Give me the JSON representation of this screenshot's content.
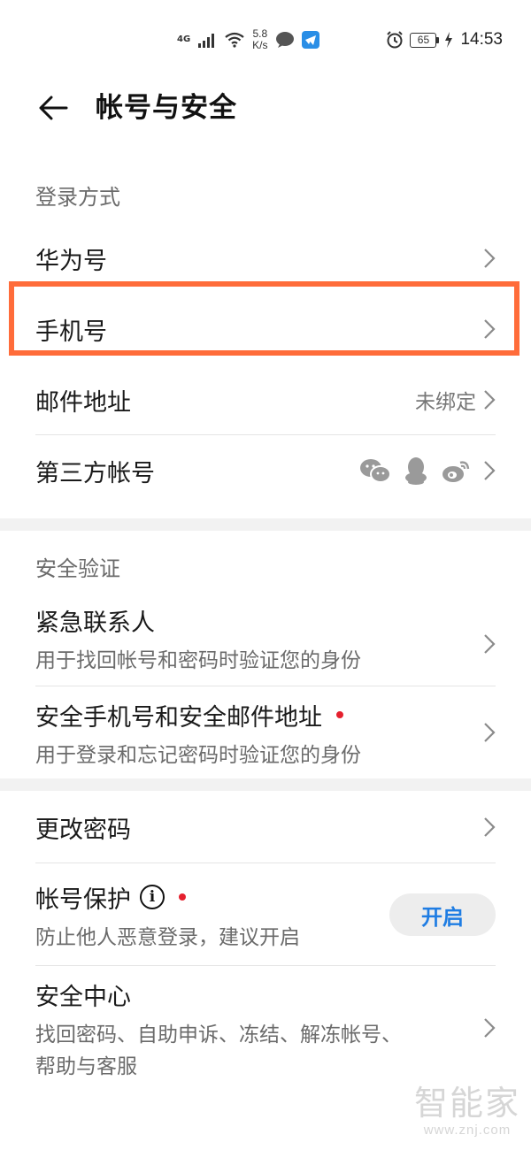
{
  "status_bar": {
    "network": "4G",
    "speed_value": "5.8",
    "speed_unit": "K/s",
    "battery": "65",
    "time": "14:53"
  },
  "header": {
    "title": "帐号与安全"
  },
  "login_section": {
    "header": "登录方式",
    "items": [
      {
        "title": "华为号"
      },
      {
        "title": "手机号"
      },
      {
        "title": "邮件地址",
        "value": "未绑定"
      },
      {
        "title": "第三方帐号"
      }
    ]
  },
  "security_section": {
    "header": "安全验证",
    "items": [
      {
        "title": "紧急联系人",
        "subtitle": "用于找回帐号和密码时验证您的身份"
      },
      {
        "title": "安全手机号和安全邮件地址",
        "subtitle": "用于登录和忘记密码时验证您的身份"
      }
    ]
  },
  "other_section": {
    "items": [
      {
        "title": "更改密码"
      },
      {
        "title": "帐号保护",
        "subtitle": "防止他人恶意登录，建议开启",
        "button": "开启"
      },
      {
        "title": "安全中心",
        "subtitle_line1": "找回密码、自助申诉、冻结、解冻帐号、",
        "subtitle_line2": "帮助与客服"
      }
    ]
  },
  "watermark": {
    "logo": "智能家",
    "url": "www.znj.com"
  },
  "colors": {
    "highlight": "#ff6c3a",
    "accent": "#1f7de3",
    "red_dot": "#e5202e"
  },
  "icons": [
    "back-arrow-icon",
    "chevron-right-icon",
    "wechat-icon",
    "qq-icon",
    "weibo-icon",
    "info-icon",
    "alarm-icon",
    "wifi-icon",
    "signal-icon",
    "message-icon",
    "telegram-icon",
    "battery-icon",
    "charging-icon"
  ]
}
